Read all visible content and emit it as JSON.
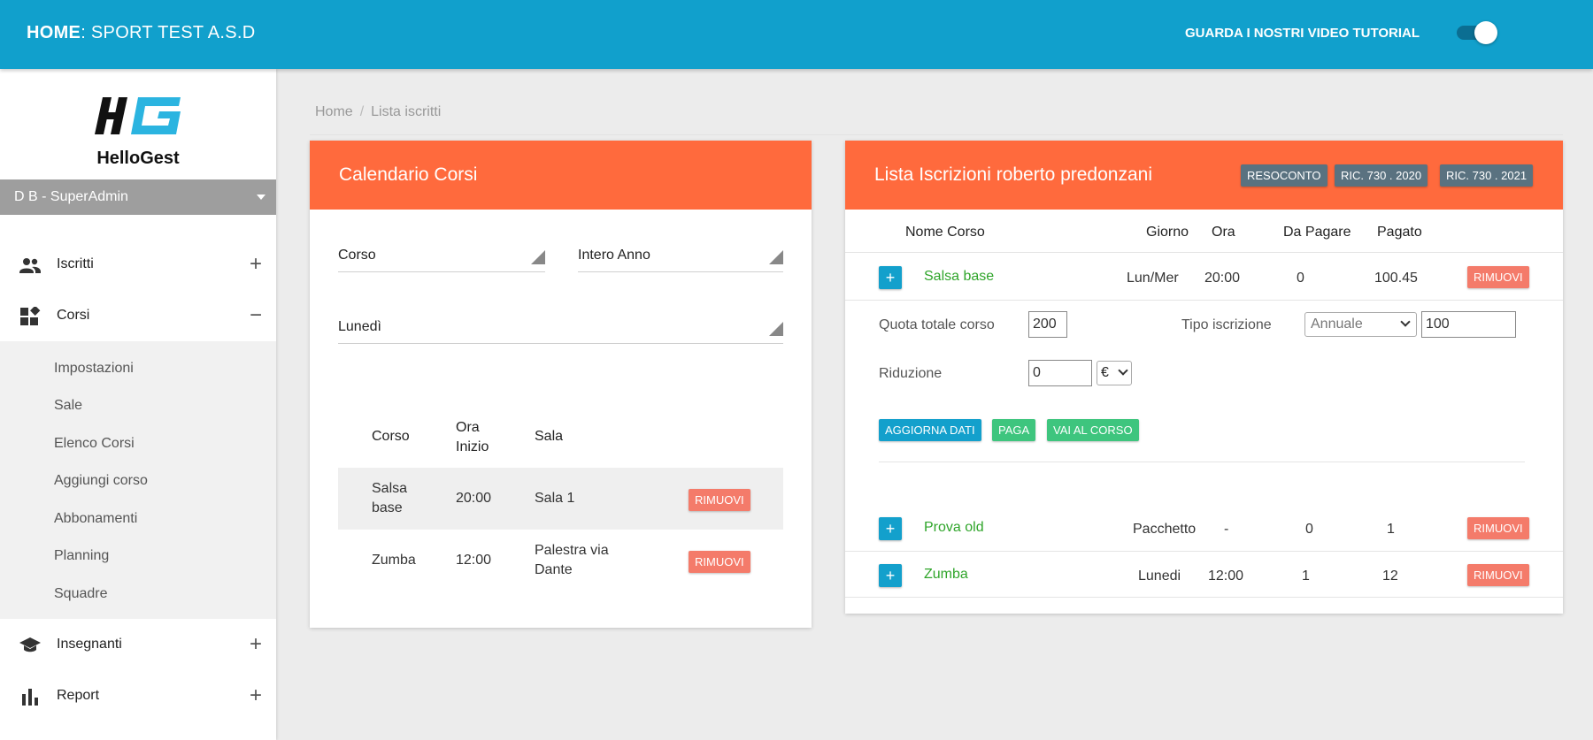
{
  "topbar": {
    "home": "HOME",
    "org": ": SPORT TEST A.S.D",
    "tutorial": "GUARDA I NOSTRI VIDEO TUTORIAL",
    "toggle_on": true
  },
  "sidebar": {
    "brand": "HelloGest",
    "user": "D B - SuperAdmin",
    "items": [
      {
        "label": "Iscritti",
        "icon": "people-icon",
        "toggle": "+"
      },
      {
        "label": "Corsi",
        "icon": "dashboard-icon",
        "toggle": "−"
      },
      {
        "label": "Insegnanti",
        "icon": "graduation-cap-icon",
        "toggle": "+"
      },
      {
        "label": "Report",
        "icon": "bar-chart-icon",
        "toggle": "+"
      }
    ],
    "sub_items": [
      "Impostazioni",
      "Sale",
      "Elenco Corsi",
      "Aggiungi corso",
      "Abbonamenti",
      "Planning",
      "Squadre"
    ]
  },
  "breadcrumb": {
    "home": "Home",
    "sep": "/",
    "current": "Lista iscritti"
  },
  "calendar": {
    "title": "Calendario Corsi",
    "filter_corso": "Corso",
    "filter_period": "Intero Anno",
    "filter_day": "Lunedì",
    "headers": {
      "corso": "Corso",
      "ora": "Ora Inizio",
      "sala": "Sala"
    },
    "rows": [
      {
        "corso": "Salsa base",
        "ora": "20:00",
        "sala": "Sala 1",
        "action": "RIMUOVI"
      },
      {
        "corso": "Zumba",
        "ora": "12:00",
        "sala": "Palestra via Dante",
        "action": "RIMUOVI"
      }
    ]
  },
  "iscrizioni": {
    "title": "Lista Iscrizioni roberto predonzani",
    "buttons": {
      "resoconto": "RESOCONTO",
      "ric2020": "RIC. 730 . 2020",
      "ric2021": "RIC. 730 . 2021"
    },
    "headers": {
      "nome": "Nome Corso",
      "giorno": "Giorno",
      "ora": "Ora",
      "da_pagare": "Da Pagare",
      "pagato": "Pagato"
    },
    "rows": [
      {
        "expand": "+",
        "nome": "Salsa base",
        "giorno": "Lun/Mer",
        "ora": "20:00",
        "da_pagare": "0",
        "pagato": "100.45",
        "action": "RIMUOVI"
      },
      {
        "expand": "+",
        "nome": "Prova old",
        "giorno": "Pacchetto",
        "ora": "-",
        "da_pagare": "0",
        "pagato": "1",
        "action": "RIMUOVI"
      },
      {
        "expand": "+",
        "nome": "Zumba",
        "giorno": "Lunedi",
        "ora": "12:00",
        "da_pagare": "1",
        "pagato": "12",
        "action": "RIMUOVI"
      }
    ],
    "detail": {
      "quota_label": "Quota totale corso",
      "quota_value": "200",
      "tipo_label": "Tipo iscrizione",
      "tipo_value": "Annuale",
      "tipo_amount": "100",
      "riduzione_label": "Riduzione",
      "riduzione_value": "0",
      "riduzione_unit": "€",
      "btn_aggiorna": "AGGIORNA DATI",
      "btn_paga": "PAGA",
      "btn_vai": "VAI AL CORSO"
    }
  },
  "colors": {
    "topbar": "#11a0cc",
    "card_header": "#ff6a3d",
    "remove_button": "#f47b6a",
    "course_link": "#2fa52a",
    "pay_button": "#3ec57e"
  }
}
